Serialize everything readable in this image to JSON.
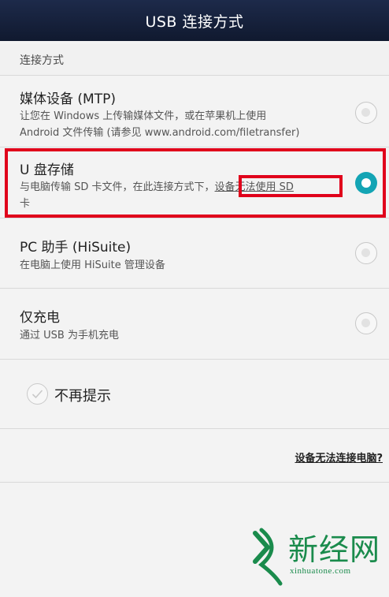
{
  "header": {
    "title": "USB 连接方式"
  },
  "section": {
    "label": "连接方式"
  },
  "options": [
    {
      "title": "媒体设备 (MTP)",
      "desc_line1": "让您在 Windows 上传输媒体文件，或在苹果机上使用",
      "desc_line2": "Android 文件传输 (请参见 www.android.com/filetransfer)",
      "selected": false
    },
    {
      "title": "U 盘存储",
      "desc_line1_prefix": "与电脑传输 SD 卡文件，在此连接方式下，",
      "desc_line1_highlight": "设备无法使用 SD",
      "desc_line2": "卡",
      "selected": true
    },
    {
      "title": "PC 助手 (HiSuite)",
      "desc_line1": "在电脑上使用 HiSuite 管理设备",
      "selected": false
    },
    {
      "title": "仅充电",
      "desc_line1": "通过 USB 为手机充电",
      "selected": false
    }
  ],
  "no_prompt": {
    "label": "不再提示",
    "checked": false
  },
  "help": {
    "link": "设备无法连接电脑?"
  },
  "watermark": {
    "text": "新经网",
    "domain": "xinhuatone.com"
  },
  "colors": {
    "header_bg": "#1d2a4a",
    "accent": "#13a4b4",
    "highlight": "#e0001b",
    "watermark": "#1a8b4c"
  }
}
